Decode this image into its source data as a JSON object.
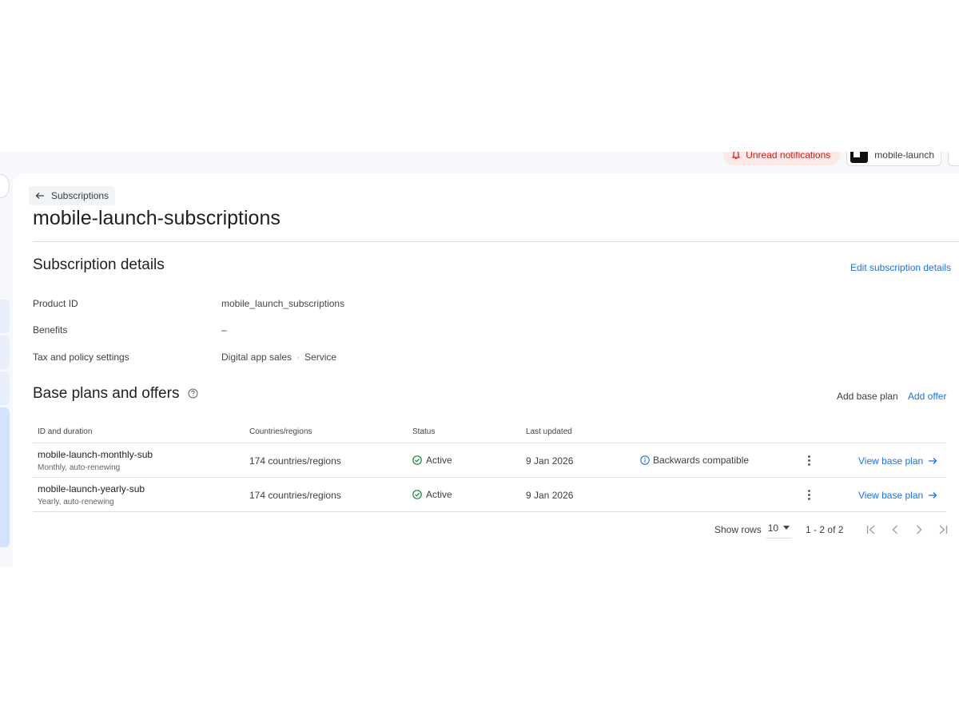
{
  "topbar": {
    "notifications_label": "Unread notifications",
    "app_name": "mobile-launch"
  },
  "back": {
    "label": "Subscriptions"
  },
  "page": {
    "title": "mobile-launch-subscriptions"
  },
  "details": {
    "title": "Subscription details",
    "edit_label": "Edit subscription details",
    "rows": [
      {
        "label": "Product ID",
        "value": "mobile_launch_subscriptions"
      },
      {
        "label": "Benefits",
        "value": "–"
      },
      {
        "label": "Tax and policy settings",
        "value": "Digital app sales",
        "value2": "Service"
      }
    ]
  },
  "plans": {
    "title": "Base plans and offers",
    "add_base_plan_label": "Add base plan",
    "add_offer_label": "Add offer",
    "columns": [
      "ID and duration",
      "Countries/regions",
      "Status",
      "Last updated"
    ],
    "rows": [
      {
        "id": "mobile-launch-monthly-sub",
        "duration": "Monthly, auto-renewing",
        "countries": "174 countries/regions",
        "status": "Active",
        "updated": "9 Jan 2026",
        "note": "Backwards compatible",
        "action": "View base plan"
      },
      {
        "id": "mobile-launch-yearly-sub",
        "duration": "Yearly, auto-renewing",
        "countries": "174 countries/regions",
        "status": "Active",
        "updated": "9 Jan 2026",
        "note": "",
        "action": "View base plan"
      }
    ]
  },
  "pagination": {
    "show_rows_label": "Show rows",
    "rows_per_page": "10",
    "range": "1 - 2 of 2"
  },
  "colors": {
    "link": "#1a73e8",
    "active_green": "#188038",
    "notification_red": "#c5221f"
  }
}
